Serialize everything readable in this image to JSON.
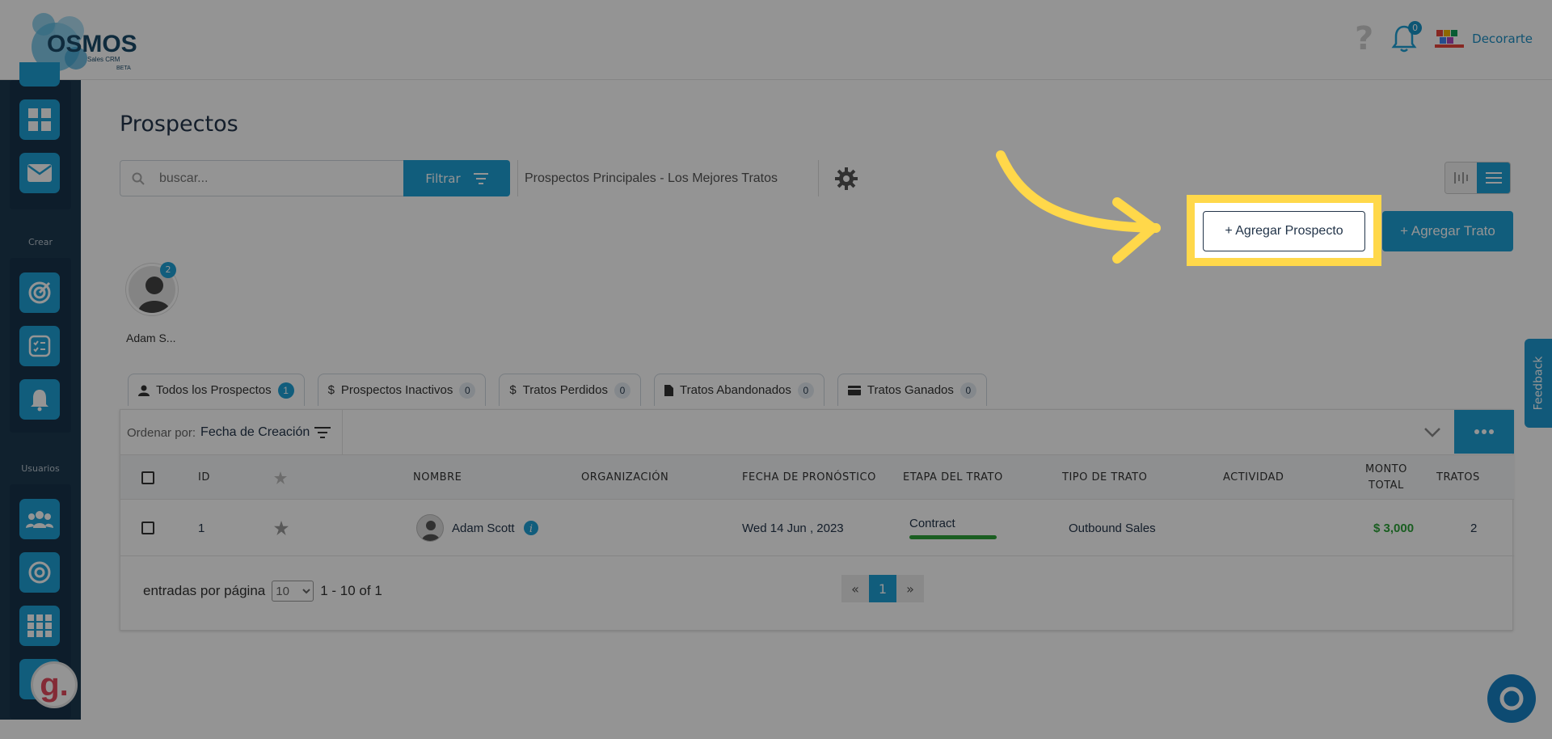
{
  "app": {
    "logo_text": "OSMOS",
    "logo_sub": "Sales CRM",
    "logo_beta": "BETA"
  },
  "header": {
    "help": "?",
    "notifications": "0",
    "company": "Decorarte"
  },
  "sidebar": {
    "section_create": "Crear",
    "section_users": "Usuarios",
    "top_items": [
      "dashboard-icon",
      "mail-icon"
    ],
    "create_items": [
      "target-icon",
      "checklist-icon",
      "alarm-bell-icon"
    ],
    "user_items": [
      "users-icon",
      "targets-icon",
      "grid-icon",
      "settings-icon"
    ]
  },
  "page": {
    "title": "Prospectos"
  },
  "search": {
    "placeholder": "buscar..."
  },
  "filter": {
    "label": "Filtrar"
  },
  "view": {
    "name": "Prospectos Principales - Los Mejores Tratos"
  },
  "actions": {
    "add_prospect": "+ Agregar Prospecto",
    "add_deal": "+ Agregar Trato"
  },
  "owner": {
    "name": "Adam S...",
    "badge": "2"
  },
  "tabs": [
    {
      "label": "Todos los Prospectos",
      "count": "1",
      "icon": "user-icon"
    },
    {
      "label": "Prospectos Inactivos",
      "count": "0",
      "icon": "dollar-icon"
    },
    {
      "label": "Tratos Perdidos",
      "count": "0",
      "icon": "dollar-icon"
    },
    {
      "label": "Tratos Abandonados",
      "count": "0",
      "icon": "document-icon"
    },
    {
      "label": "Tratos Ganados",
      "count": "0",
      "icon": "card-icon"
    }
  ],
  "sort": {
    "label": "Ordenar por:",
    "value": "Fecha de Creación"
  },
  "table": {
    "columns": [
      "ID",
      "NOMBRE",
      "ORGANIZACIÓN",
      "FECHA DE PRONÓSTICO",
      "ETAPA DEL TRATO",
      "TIPO DE TRATO",
      "ACTIVIDAD",
      "MONTO",
      "TOTAL",
      "TRATOS"
    ],
    "rows": [
      {
        "id": "1",
        "name": "Adam Scott",
        "organization": "",
        "forecast_date": "Wed 14 Jun , 2023",
        "stage": "Contract",
        "deal_type": "Outbound Sales",
        "activity": "",
        "amount": "$ 3,000",
        "deals": "2"
      }
    ]
  },
  "pagination": {
    "per_page_label": "entradas por página",
    "per_page": "10",
    "range": "1 - 10 of 1",
    "prev": "«",
    "current": "1",
    "next": "»"
  },
  "feedback": {
    "label": "Feedback"
  },
  "colors": {
    "accent": "#1ea0d6",
    "highlight": "#ffd84a",
    "amount": "#2ea33a",
    "stage_bar": "#2ea33a"
  }
}
